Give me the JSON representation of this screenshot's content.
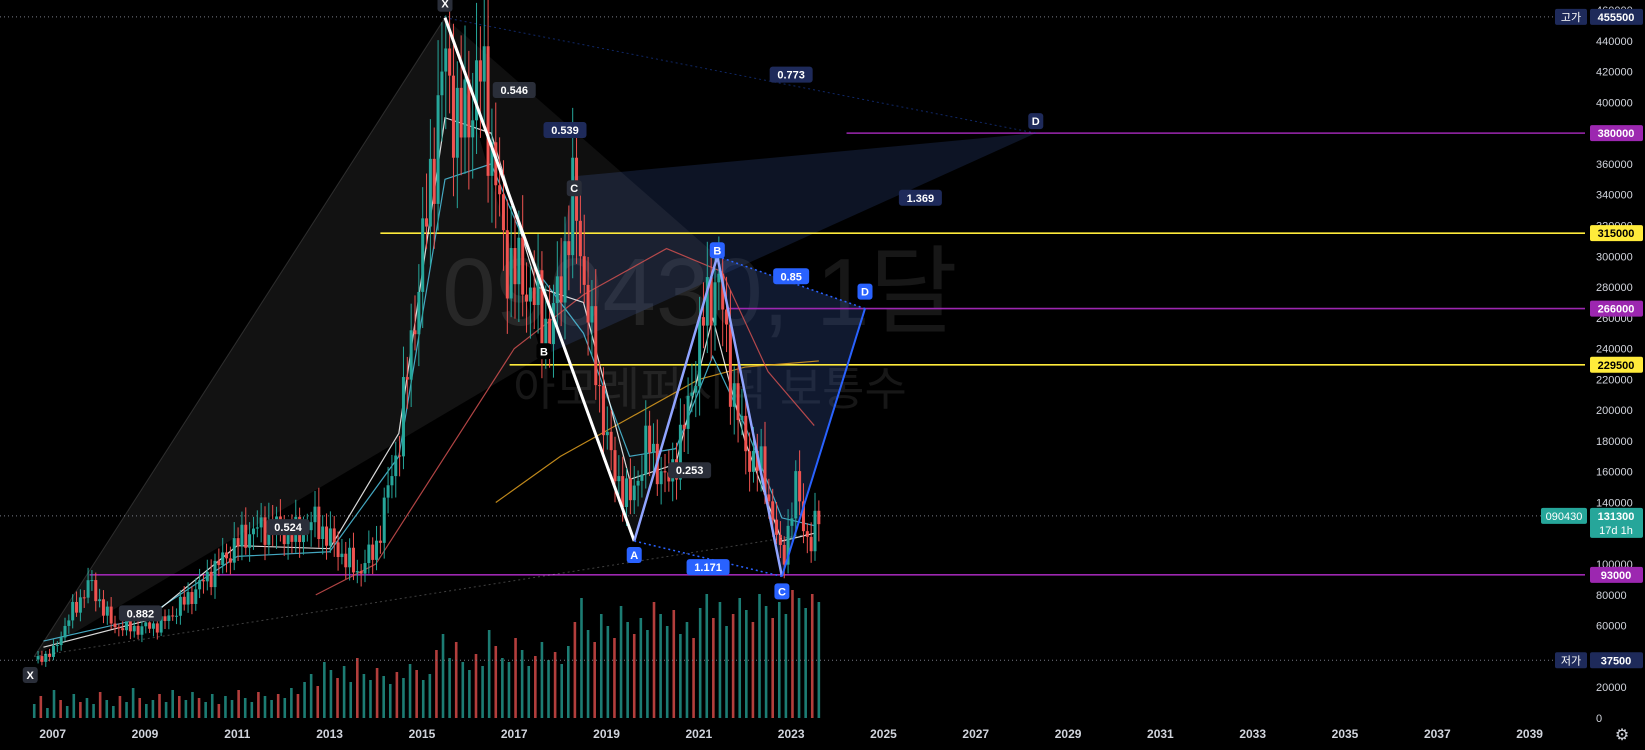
{
  "watermark": {
    "symbol": "090430, 1달",
    "name": "아모레퍼시픽 보통수"
  },
  "chart_data": {
    "type": "candlestick",
    "title": "",
    "xlabel": "",
    "ylabel": "",
    "xlim": [
      2006.4,
      2040.2
    ],
    "ylim": [
      0,
      460000
    ],
    "x_ticks": [
      {
        "x": 2007,
        "label": "2007"
      },
      {
        "x": 2009,
        "label": "2009"
      },
      {
        "x": 2011,
        "label": "2011"
      },
      {
        "x": 2013,
        "label": "2013"
      },
      {
        "x": 2015,
        "label": "2015"
      },
      {
        "x": 2017,
        "label": "2017"
      },
      {
        "x": 2019,
        "label": "2019"
      },
      {
        "x": 2021,
        "label": "2021"
      },
      {
        "x": 2023,
        "label": "2023"
      },
      {
        "x": 2025,
        "label": "2025"
      },
      {
        "x": 2027,
        "label": "2027"
      },
      {
        "x": 2029,
        "label": "2029"
      },
      {
        "x": 2031,
        "label": "2031"
      },
      {
        "x": 2033,
        "label": "2033"
      },
      {
        "x": 2035,
        "label": "2035"
      },
      {
        "x": 2037,
        "label": "2037"
      },
      {
        "x": 2039,
        "label": "2039"
      }
    ],
    "y_ticks": [
      {
        "v": 0,
        "label": "0"
      },
      {
        "v": 20000,
        "label": "20000"
      },
      {
        "v": 40000,
        "label": "40000"
      },
      {
        "v": 60000,
        "label": "60000"
      },
      {
        "v": 80000,
        "label": "80000"
      },
      {
        "v": 100000,
        "label": "100000"
      },
      {
        "v": 120000,
        "label": "120000"
      },
      {
        "v": 140000,
        "label": "140000"
      },
      {
        "v": 160000,
        "label": "160000"
      },
      {
        "v": 180000,
        "label": "180000"
      },
      {
        "v": 200000,
        "label": "200000"
      },
      {
        "v": 220000,
        "label": "220000"
      },
      {
        "v": 240000,
        "label": "240000"
      },
      {
        "v": 260000,
        "label": "260000"
      },
      {
        "v": 280000,
        "label": "280000"
      },
      {
        "v": 300000,
        "label": "300000"
      },
      {
        "v": 320000,
        "label": "320000"
      },
      {
        "v": 340000,
        "label": "340000"
      },
      {
        "v": 360000,
        "label": "360000"
      },
      {
        "v": 380000,
        "label": "380000"
      },
      {
        "v": 400000,
        "label": "400000"
      },
      {
        "v": 420000,
        "label": "420000"
      },
      {
        "v": 440000,
        "label": "440000"
      },
      {
        "v": 460000,
        "label": "460000"
      }
    ],
    "price_path": [
      [
        2006.6,
        38000
      ],
      [
        2007.0,
        42000
      ],
      [
        2007.3,
        62000
      ],
      [
        2007.8,
        88000
      ],
      [
        2008.3,
        60000
      ],
      [
        2008.9,
        58000
      ],
      [
        2009.4,
        62000
      ],
      [
        2010.0,
        80000
      ],
      [
        2010.6,
        100000
      ],
      [
        2011.2,
        120000
      ],
      [
        2011.7,
        125000
      ],
      [
        2012.2,
        118000
      ],
      [
        2012.7,
        128000
      ],
      [
        2013.1,
        112000
      ],
      [
        2013.6,
        95000
      ],
      [
        2014.0,
        110000
      ],
      [
        2014.5,
        180000
      ],
      [
        2015.0,
        300000
      ],
      [
        2015.5,
        430000
      ],
      [
        2015.8,
        380000
      ],
      [
        2016.3,
        420000
      ],
      [
        2016.8,
        300000
      ],
      [
        2017.3,
        280000
      ],
      [
        2017.8,
        250000
      ],
      [
        2018.3,
        340000
      ],
      [
        2018.7,
        240000
      ],
      [
        2019.1,
        165000
      ],
      [
        2019.5,
        140000
      ],
      [
        2019.9,
        180000
      ],
      [
        2020.3,
        150000
      ],
      [
        2020.7,
        190000
      ],
      [
        2021.1,
        260000
      ],
      [
        2021.4,
        290000
      ],
      [
        2021.7,
        220000
      ],
      [
        2022.0,
        175000
      ],
      [
        2022.4,
        160000
      ],
      [
        2022.8,
        100000
      ],
      [
        2023.1,
        150000
      ],
      [
        2023.4,
        110000
      ],
      [
        2023.6,
        131300
      ]
    ],
    "ma_lines": [
      {
        "color": "#e0a020",
        "points": [
          [
            2016.6,
            140000
          ],
          [
            2018.0,
            170000
          ],
          [
            2019.5,
            195000
          ],
          [
            2021.0,
            220000
          ],
          [
            2022.0,
            228000
          ],
          [
            2023.6,
            232000
          ]
        ]
      },
      {
        "color": "#d05050",
        "points": [
          [
            2012.7,
            80000
          ],
          [
            2014.0,
            100000
          ],
          [
            2015.5,
            170000
          ],
          [
            2017.0,
            240000
          ],
          [
            2018.5,
            275000
          ],
          [
            2020.3,
            305000
          ],
          [
            2021.5,
            290000
          ],
          [
            2022.5,
            225000
          ],
          [
            2023.5,
            190000
          ]
        ]
      },
      {
        "color": "#4fc3e0",
        "points": [
          [
            2006.8,
            50000
          ],
          [
            2009,
            65000
          ],
          [
            2011,
            105000
          ],
          [
            2013,
            108000
          ],
          [
            2014.5,
            170000
          ],
          [
            2015.5,
            350000
          ],
          [
            2016.5,
            360000
          ],
          [
            2017.5,
            290000
          ],
          [
            2018.5,
            250000
          ],
          [
            2019.5,
            170000
          ],
          [
            2020.5,
            175000
          ],
          [
            2021.3,
            235000
          ],
          [
            2022.0,
            190000
          ],
          [
            2022.8,
            130000
          ],
          [
            2023.5,
            125000
          ]
        ]
      },
      {
        "color": "#ffffff",
        "points": [
          [
            2006.8,
            46000
          ],
          [
            2009,
            63000
          ],
          [
            2011,
            112000
          ],
          [
            2013,
            110000
          ],
          [
            2014.5,
            185000
          ],
          [
            2015.5,
            390000
          ],
          [
            2016.5,
            380000
          ],
          [
            2017.5,
            280000
          ],
          [
            2018.5,
            270000
          ],
          [
            2019.5,
            155000
          ],
          [
            2020.5,
            165000
          ],
          [
            2021.3,
            260000
          ],
          [
            2022.0,
            180000
          ],
          [
            2022.8,
            115000
          ],
          [
            2023.5,
            120000
          ]
        ]
      }
    ],
    "horizontal_levels": [
      {
        "value": 380000,
        "label": "380000",
        "color": "#9c27b0",
        "x_start": 2024.2
      },
      {
        "value": 315000,
        "label": "315000",
        "color": "#ffeb3b",
        "x_start": 2014.1
      },
      {
        "value": 266000,
        "label": "266000",
        "color": "#9c27b0",
        "x_start": 2021.6
      },
      {
        "value": 229500,
        "label": "229500",
        "color": "#ffeb3b",
        "x_start": 2016.9
      },
      {
        "value": 93000,
        "label": "93000",
        "color": "#9c27b0",
        "x_start": 2007.8
      }
    ],
    "price_markers": {
      "high": {
        "tag": "고가",
        "value": 455500,
        "label": "455500"
      },
      "low": {
        "tag": "저가",
        "value": 37500,
        "label": "37500"
      },
      "current": {
        "symbol": "090430",
        "value": 131300,
        "label": "131300",
        "countdown": "17d 1h"
      }
    },
    "patterns": [
      {
        "name": "large",
        "points": {
          "X": [
            2006.6,
            40000
          ],
          "A": [
            2015.5,
            455000
          ],
          "B": [
            2017.6,
            235000
          ],
          "C": [
            2018.3,
            352000
          ],
          "D": [
            2028.3,
            380000
          ]
        },
        "labels": {
          "X": "X",
          "A": "X",
          "B": "B",
          "C": "C",
          "D": "D"
        },
        "ratios": [
          {
            "text": "0.524",
            "x": 2012.1,
            "y": 124000
          },
          {
            "text": "0.546",
            "x": 2017.0,
            "y": 408000
          },
          {
            "text": "0.539",
            "x": 2018.1,
            "y": 382000
          },
          {
            "text": "0.773",
            "x": 2023.0,
            "y": 418000
          },
          {
            "text": "1.369",
            "x": 2025.8,
            "y": 338000
          },
          {
            "text": "0.882",
            "x": 2008.9,
            "y": 68000
          }
        ]
      },
      {
        "name": "small",
        "points": {
          "X": [
            2015.5,
            455000
          ],
          "A": [
            2019.6,
            115000
          ],
          "B": [
            2021.4,
            300000
          ],
          "C": [
            2022.8,
            92000
          ],
          "D": [
            2024.6,
            266000
          ]
        },
        "labels": {
          "X": "",
          "A": "A",
          "B": "B",
          "C": "C",
          "D": "D"
        },
        "ratios": [
          {
            "text": "0.253",
            "x": 2020.8,
            "y": 161000
          },
          {
            "text": "0.85",
            "x": 2023.0,
            "y": 287000
          },
          {
            "text": "1.171",
            "x": 2021.2,
            "y": 98000
          }
        ]
      }
    ],
    "volume": [
      7,
      11,
      5,
      14,
      9,
      6,
      12,
      8,
      10,
      7,
      13,
      9,
      6,
      11,
      8,
      15,
      10,
      7,
      9,
      12,
      8,
      14,
      11,
      9,
      13,
      10,
      8,
      12,
      7,
      11,
      9,
      14,
      10,
      8,
      13,
      11,
      9,
      12,
      10,
      15,
      12,
      18,
      22,
      16,
      28,
      24,
      20,
      26,
      18,
      30,
      22,
      19,
      25,
      21,
      17,
      23,
      20,
      27,
      24,
      19,
      22,
      34,
      42,
      30,
      38,
      28,
      24,
      32,
      26,
      44,
      36,
      30,
      28,
      40,
      34,
      26,
      31,
      38,
      29,
      33,
      27,
      36,
      48,
      60,
      44,
      38,
      52,
      46,
      40,
      56,
      48,
      42,
      50,
      44,
      58,
      52,
      46,
      54,
      42,
      48,
      40,
      55,
      62,
      50,
      58,
      46,
      52,
      60,
      54,
      48,
      62,
      56,
      50,
      58,
      52,
      64,
      60,
      55,
      62,
      58
    ],
    "volume_max": 70
  }
}
